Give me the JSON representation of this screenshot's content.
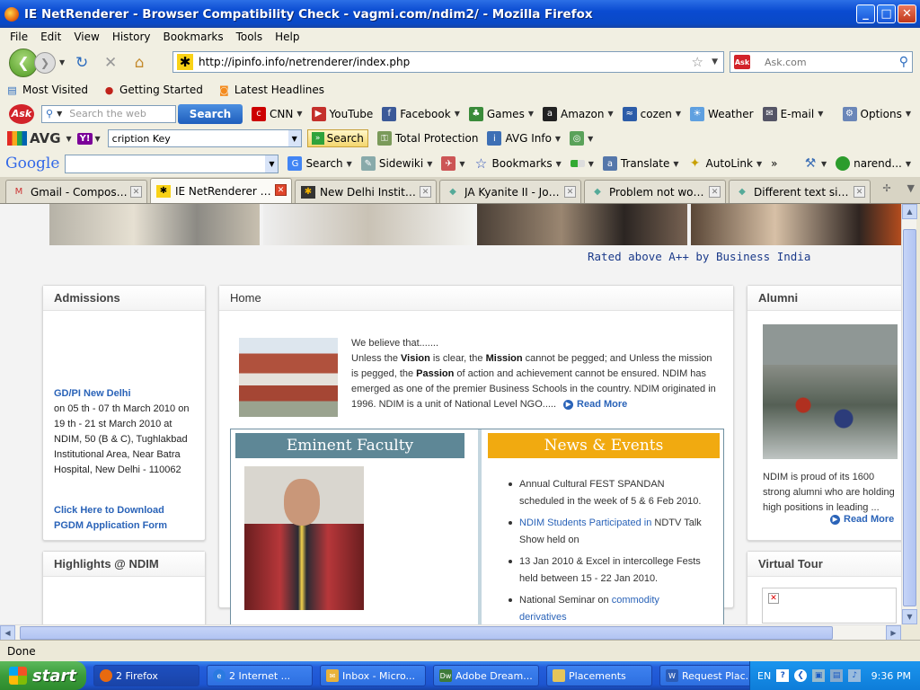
{
  "window": {
    "title": "IE NetRenderer - Browser Compatibility Check - vagmi.com/ndim2/ - Mozilla Firefox",
    "minimize": "_",
    "maximize": "□",
    "close": "✕"
  },
  "menu": [
    "File",
    "Edit",
    "View",
    "History",
    "Bookmarks",
    "Tools",
    "Help"
  ],
  "nav": {
    "url": "http://ipinfo.info/netrenderer/index.php",
    "search_placeholder": "Ask.com"
  },
  "bookmarks": [
    "Most Visited",
    "Getting Started",
    "Latest Headlines"
  ],
  "ask_toolbar": {
    "search_placeholder": "Search the web",
    "search_button": "Search",
    "items": [
      "CNN",
      "YouTube",
      "Facebook",
      "Games",
      "Amazon",
      "cozen",
      "Weather",
      "E-mail"
    ],
    "options": "Options"
  },
  "avg_toolbar": {
    "logo": "AVG",
    "field_value": "cription Key",
    "search_button": "Search",
    "protection": "Total Protection",
    "info": "AVG Info"
  },
  "google_toolbar": {
    "logo": "Google",
    "items": [
      "Search",
      "Sidewiki",
      "Bookmarks",
      "Translate",
      "AutoLink",
      "»"
    ],
    "user": "narend..."
  },
  "tabs": [
    {
      "label": "Gmail - Compose Mai...",
      "active": false
    },
    {
      "label": "IE NetRenderer - ...",
      "active": true
    },
    {
      "label": "New Delhi Institute ...",
      "active": false
    },
    {
      "label": "JA Kyanite II - Jooml...",
      "active": false
    },
    {
      "label": "Problem not working...",
      "active": false
    },
    {
      "label": "Different text size / l...",
      "active": false
    }
  ],
  "page": {
    "rated": "Rated above A++ by Business India",
    "admissions": {
      "title": "Admissions",
      "gdpi": "GD/PI New Delhi",
      "details": "on 05 th - 07 th March 2010 on 19 th - 21 st March 2010 at NDIM, 50 (B & C), Tughlakbad Institutional Area, Near Batra Hospital, New Delhi - 110062",
      "download": "Click Here to Download PGDM Application Form"
    },
    "highlights_title": "Highlights @ NDIM",
    "home": {
      "title": "Home",
      "intro": "We believe that.......",
      "vision_1": "Unless the ",
      "vision_word": "Vision",
      "vision_2": " is clear, the ",
      "mission_word": "Mission",
      "vision_3": " cannot be pegged; and Unless the mission is pegged, the ",
      "passion_word": "Passion",
      "vision_4": " of action and achievement cannot be ensured. NDIM has emerged as one of the premier Business Schools in the country. NDIM originated in 1996. NDIM is a unit of National Level NGO.....",
      "read_more": "Read More"
    },
    "faculty_title": "Eminent Faculty",
    "news": {
      "title": "News & Events",
      "items": [
        {
          "text": "Annual Cultural FEST SPANDAN scheduled in the week of 5 & 6 Feb 2010.",
          "link": ""
        },
        {
          "link": "NDIM Students Participated in",
          "text": " NDTV Talk Show held on"
        },
        {
          "text": "13 Jan 2010 & Excel in intercollege Fests held between 15 - 22 Jan 2010.",
          "link": ""
        },
        {
          "text": "National Seminar on ",
          "link": "commodity derivatives"
        }
      ]
    },
    "alumni": {
      "title": "Alumni",
      "text": "NDIM is proud of its 1600 strong alumni who are holding high positions in leading ...",
      "read_more": "Read More"
    },
    "virtual_tour_title": "Virtual Tour"
  },
  "status": "Done",
  "taskbar": {
    "start": "start",
    "tasks": [
      "2 Firefox",
      "2 Internet ...",
      "Inbox - Micro...",
      "Adobe Dream...",
      "Placements",
      "Request Plac..."
    ],
    "lang": "EN",
    "clock": "9:36 PM"
  }
}
